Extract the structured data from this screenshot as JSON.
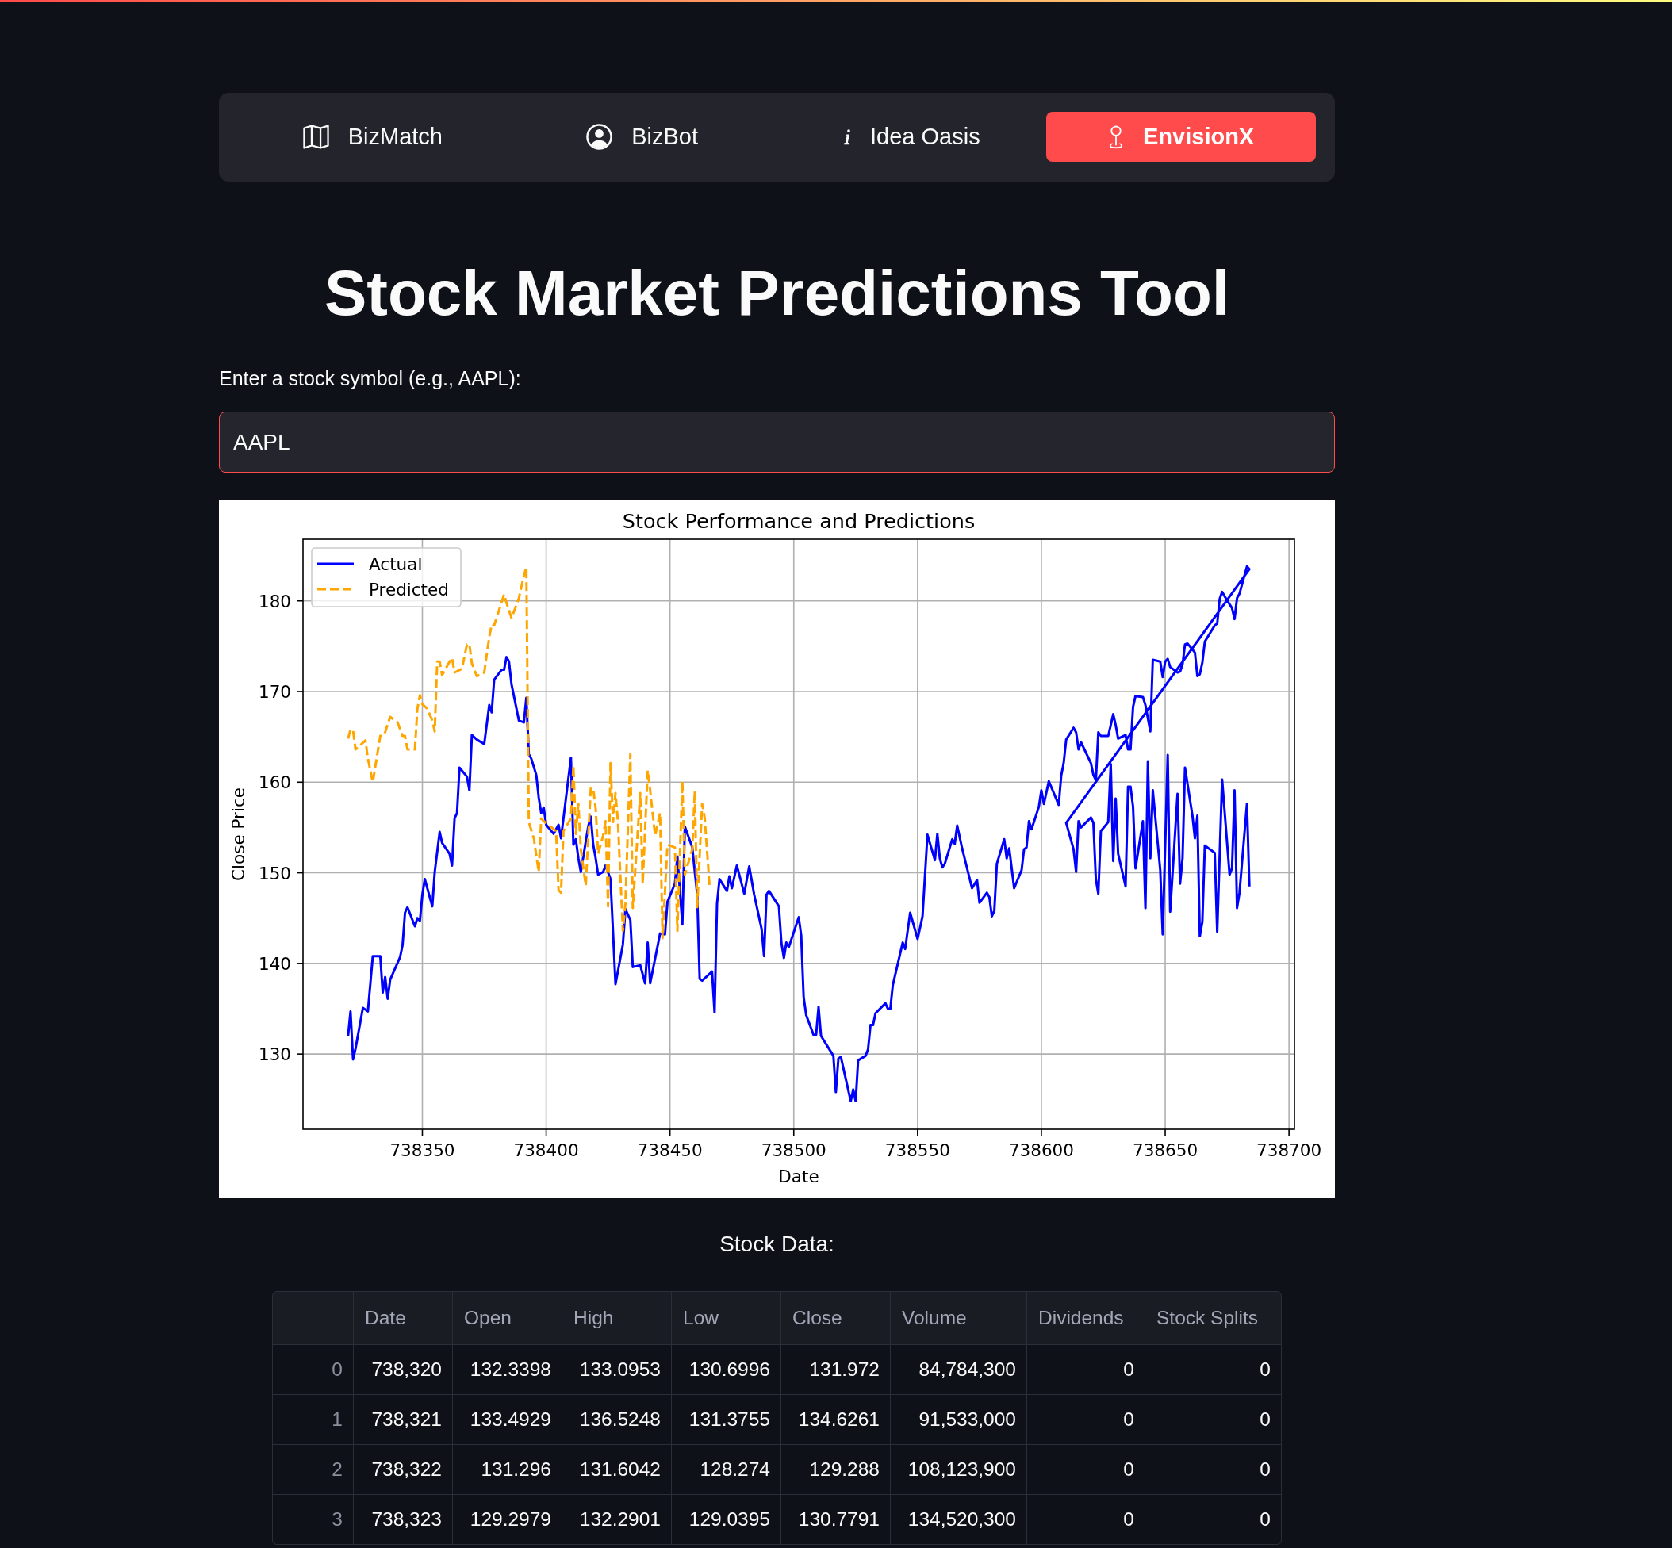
{
  "nav_menu": {
    "items": [
      {
        "label": "BizMatch",
        "selected": false
      },
      {
        "label": "BizBot",
        "selected": false
      },
      {
        "label": "Idea Oasis",
        "selected": false
      },
      {
        "label": "EnvisionX",
        "selected": true
      }
    ]
  },
  "page_title": "Stock Market Predictions Tool",
  "symbol_input": {
    "label": "Enter a stock symbol (e.g., AAPL):",
    "value": "AAPL",
    "focused": true
  },
  "stock_chart": {
    "chart_data": {
      "type": "line",
      "title": "Stock Performance and Predictions",
      "xlabel": "Date",
      "ylabel": "Close Price",
      "xlim": [
        738301.8,
        738702.2
      ],
      "ylim": [
        121.7,
        186.8
      ],
      "xticks": [
        738350,
        738400,
        738450,
        738500,
        738550,
        738600,
        738650,
        738700
      ],
      "yticks": [
        130,
        140,
        150,
        160,
        170,
        180
      ],
      "grid": true,
      "legend": true,
      "series": [
        {
          "name": "Actual",
          "color": "#0000ff",
          "line_style": "solid",
          "x": [
            738320,
            738321,
            738322,
            738323,
            738326,
            738328,
            738330,
            738333,
            738334,
            738335,
            738336,
            738337,
            738341,
            738342,
            738343,
            738344,
            738347,
            738348,
            738349,
            738350,
            738351,
            738354,
            738355,
            738357,
            738358,
            738361,
            738362,
            738363,
            738364,
            738365,
            738368,
            738369,
            738370,
            738372,
            738375,
            738377,
            738378,
            738379,
            738382,
            738383,
            738384,
            738385,
            738386,
            738389,
            738391,
            738392,
            738393,
            738394,
            738396,
            738397,
            738398,
            738399,
            738400,
            738403,
            738405,
            738406,
            738410,
            738411,
            738412,
            738413,
            738414,
            738417,
            738418,
            738419,
            738420,
            738421,
            738423,
            738424,
            738426,
            738428,
            738431,
            738432,
            738434,
            738435,
            738438,
            738440,
            738441,
            738442,
            738446,
            738448,
            738449,
            738452,
            738453,
            738455,
            738456,
            738459,
            738461,
            738462,
            738463,
            738467,
            738468,
            738469,
            738470,
            738473,
            738474,
            738475,
            738477,
            738480,
            738482,
            738484,
            738487,
            738488,
            738489,
            738490,
            738494,
            738495,
            738496,
            738497,
            738498,
            738502,
            738503,
            738504,
            738505,
            738508,
            738509,
            738510,
            738511,
            738516,
            738517,
            738518,
            738519,
            738523,
            738524,
            738525,
            738526,
            738529,
            738530,
            738531,
            738532,
            738533,
            738537,
            738538,
            738539,
            738540,
            738544,
            738545,
            738547,
            738550,
            738552,
            738554,
            738557,
            738558,
            738559,
            738560,
            738561,
            738564,
            738565,
            738566,
            738568,
            738572,
            738574,
            738575,
            738578,
            738579,
            738580,
            738581,
            738582,
            738585,
            738586,
            738587,
            738589,
            738592,
            738593,
            738594,
            738595,
            738596,
            738599,
            738600,
            738601,
            738603,
            738607,
            738608,
            738609,
            738610,
            738613,
            738614,
            738615,
            738616,
            738620,
            738621,
            738622,
            738623,
            738624,
            738627,
            738628,
            738629,
            738630,
            738631,
            738634,
            738635,
            738636,
            738637,
            738638,
            738641,
            738642,
            738644,
            738645,
            738648,
            738649,
            738650,
            738651,
            738652,
            738655,
            738656,
            738657,
            738658,
            738659,
            738662,
            738663,
            738664,
            738665,
            738666,
            738670,
            738671,
            738672,
            738673,
            738674,
            738677,
            738678,
            738679,
            738680,
            738683,
            738684,
            738610,
            738613,
            738614,
            738615,
            738616,
            738620,
            738621,
            738622,
            738623,
            738624,
            738627,
            738628,
            738629,
            738630,
            738631,
            738634,
            738635,
            738636,
            738637,
            738638,
            738641,
            738642,
            738643,
            738644,
            738645,
            738648,
            738649,
            738651,
            738652,
            738655,
            738656,
            738657,
            738658,
            738661,
            738662,
            738663,
            738664,
            738665,
            738666,
            738670,
            738671,
            738673,
            738676,
            738677,
            738678,
            738679,
            738680,
            738683,
            738684
          ],
          "values": [
            132.0,
            134.7,
            129.4,
            130.6,
            135.1,
            134.7,
            140.8,
            140.8,
            136.8,
            138.5,
            136.1,
            138.2,
            140.7,
            142.0,
            145.6,
            146.2,
            144.1,
            145.0,
            144.7,
            147.6,
            149.3,
            146.3,
            150.1,
            154.5,
            153.3,
            152.1,
            150.8,
            156.0,
            156.6,
            161.6,
            160.6,
            159.1,
            165.2,
            164.7,
            164.2,
            168.5,
            167.7,
            171.3,
            172.4,
            172.4,
            173.8,
            173.3,
            170.8,
            166.8,
            166.6,
            169.3,
            163.1,
            162.6,
            160.8,
            158.3,
            156.6,
            157.2,
            155.3,
            154.3,
            155.3,
            153.8,
            162.7,
            153.1,
            153.7,
            151.6,
            150.1,
            155.1,
            156.2,
            153.1,
            151.6,
            149.8,
            150.1,
            150.8,
            149.3,
            137.7,
            142.1,
            146.0,
            144.8,
            139.6,
            139.8,
            137.8,
            142.3,
            137.8,
            143.3,
            143.2,
            146.8,
            148.8,
            151.8,
            144.3,
            155.1,
            152.8,
            147.6,
            138.3,
            138.1,
            139.1,
            134.6,
            146.6,
            149.3,
            148.0,
            149.6,
            148.3,
            150.8,
            147.7,
            150.7,
            147.6,
            143.8,
            140.8,
            147.6,
            148.0,
            146.3,
            142.3,
            140.6,
            142.3,
            141.8,
            145.1,
            143.1,
            136.3,
            134.3,
            132.1,
            132.1,
            135.2,
            132.0,
            129.8,
            125.8,
            129.5,
            129.7,
            124.8,
            126.1,
            124.8,
            129.3,
            129.8,
            130.5,
            133.2,
            133.2,
            134.5,
            135.6,
            135.0,
            135.0,
            137.6,
            142.3,
            141.6,
            145.6,
            142.7,
            145.2,
            154.2,
            151.4,
            154.3,
            151.6,
            150.6,
            151.0,
            153.7,
            153.2,
            155.2,
            152.7,
            148.3,
            149.2,
            146.7,
            147.8,
            147.3,
            145.2,
            145.8,
            151.0,
            153.7,
            151.6,
            152.7,
            148.3,
            150.3,
            152.6,
            152.8,
            155.7,
            154.8,
            157.3,
            159.1,
            157.6,
            160.1,
            157.5,
            160.7,
            162.1,
            164.7,
            166.0,
            165.5,
            163.6,
            164.4,
            162.1,
            160.8,
            160.2,
            165.5,
            165.1,
            165.1,
            166.3,
            167.5,
            166.3,
            164.8,
            165.2,
            163.6,
            163.6,
            168.3,
            169.5,
            169.4,
            168.5,
            165.6,
            173.5,
            173.3,
            171.6,
            173.3,
            173.6,
            172.7,
            172.1,
            172.2,
            173.0,
            175.2,
            175.3,
            174.3,
            171.7,
            171.9,
            173.2,
            175.5,
            177.3,
            177.5,
            180.2,
            181.0,
            180.5,
            179.2,
            178.0,
            180.3,
            180.8,
            183.8,
            183.5,
            155.5,
            152.6,
            150.1,
            155.7,
            155.0,
            156.1,
            155.5,
            149.3,
            147.7,
            154.6,
            155.6,
            162.0,
            151.3,
            158.2,
            152.1,
            148.5,
            159.5,
            159.5,
            157.3,
            150.5,
            155.7,
            146.1,
            162.3,
            151.6,
            159.1,
            150.3,
            143.2,
            163.0,
            145.7,
            158.7,
            148.8,
            151.6,
            161.6,
            156.3,
            153.8,
            156.3,
            143.0,
            144.6,
            153.0,
            152.2,
            143.5,
            160.3,
            149.8,
            150.5,
            159.1,
            146.1,
            147.8,
            157.6,
            148.5
          ]
        },
        {
          "name": "Predicted",
          "color": "#ffa500",
          "line_style": "dashed",
          "x": [
            738320,
            738321,
            738322,
            738323,
            738327,
            738328,
            738330,
            738333,
            738334,
            738335,
            738337,
            738340,
            738342,
            738343,
            738344,
            738347,
            738348,
            738349,
            738350,
            738352,
            738354,
            738355,
            738356,
            738357,
            738358,
            738361,
            738362,
            738363,
            738366,
            738368,
            738369,
            738370,
            738372,
            738375,
            738377,
            738378,
            738379,
            738383,
            738384,
            738386,
            738389,
            738391,
            738392,
            738393,
            738395,
            738397,
            738398,
            738399,
            738404,
            738405,
            738406,
            738407,
            738410,
            738411,
            738412,
            738413,
            738414,
            738416,
            738418,
            738419,
            738420,
            738421,
            738423,
            738424,
            738425,
            738426,
            738427,
            738428,
            738429,
            738431,
            738432,
            738434,
            738435,
            738438,
            738439,
            738441,
            738442,
            738444,
            738446,
            738447,
            738449,
            738452,
            738453,
            738455,
            738456,
            738459,
            738460,
            738461,
            738463,
            738464,
            738466
          ],
          "values": [
            164.8,
            165.8,
            165.7,
            163.6,
            164.6,
            162.6,
            160.0,
            165.1,
            165.1,
            165.5,
            167.2,
            166.6,
            165.1,
            165.1,
            163.6,
            163.6,
            168.1,
            169.6,
            168.6,
            168.1,
            166.8,
            165.6,
            173.3,
            173.3,
            171.8,
            173.3,
            173.7,
            172.1,
            172.5,
            175.2,
            175.2,
            173.1,
            171.7,
            172.1,
            176.0,
            177.4,
            177.3,
            180.7,
            179.8,
            178.1,
            180.3,
            182.8,
            183.7,
            155.6,
            153.8,
            150.1,
            156.0,
            155.7,
            154.6,
            148.1,
            147.8,
            154.6,
            156.0,
            161.8,
            154.3,
            157.6,
            152.6,
            148.6,
            159.3,
            159.3,
            157.1,
            152.1,
            154.1,
            155.7,
            146.3,
            162.1,
            155.6,
            158.8,
            155.6,
            143.6,
            146.6,
            163.1,
            146.1,
            158.8,
            148.8,
            161.3,
            159.1,
            154.1,
            156.6,
            142.8,
            153.1,
            152.8,
            143.6,
            160.1,
            149.8,
            152.6,
            159.0,
            146.2,
            157.6,
            156.1,
            148.5
          ]
        }
      ]
    }
  },
  "stock_data": {
    "heading": "Stock Data:",
    "table": {
      "columns": [
        "Date",
        "Open",
        "High",
        "Low",
        "Close",
        "Volume",
        "Dividends",
        "Stock Splits"
      ],
      "rows": [
        {
          "index": "0",
          "cells": [
            "738,320",
            "132.3398",
            "133.0953",
            "130.6996",
            "131.972",
            "84,784,300",
            "0",
            "0"
          ]
        },
        {
          "index": "1",
          "cells": [
            "738,321",
            "133.4929",
            "136.5248",
            "131.3755",
            "134.6261",
            "91,533,000",
            "0",
            "0"
          ]
        },
        {
          "index": "2",
          "cells": [
            "738,322",
            "131.296",
            "131.6042",
            "128.274",
            "129.288",
            "108,123,900",
            "0",
            "0"
          ]
        },
        {
          "index": "3",
          "cells": [
            "738,323",
            "129.2979",
            "132.2901",
            "129.0395",
            "130.7791",
            "134,520,300",
            "0",
            "0"
          ]
        }
      ]
    }
  }
}
